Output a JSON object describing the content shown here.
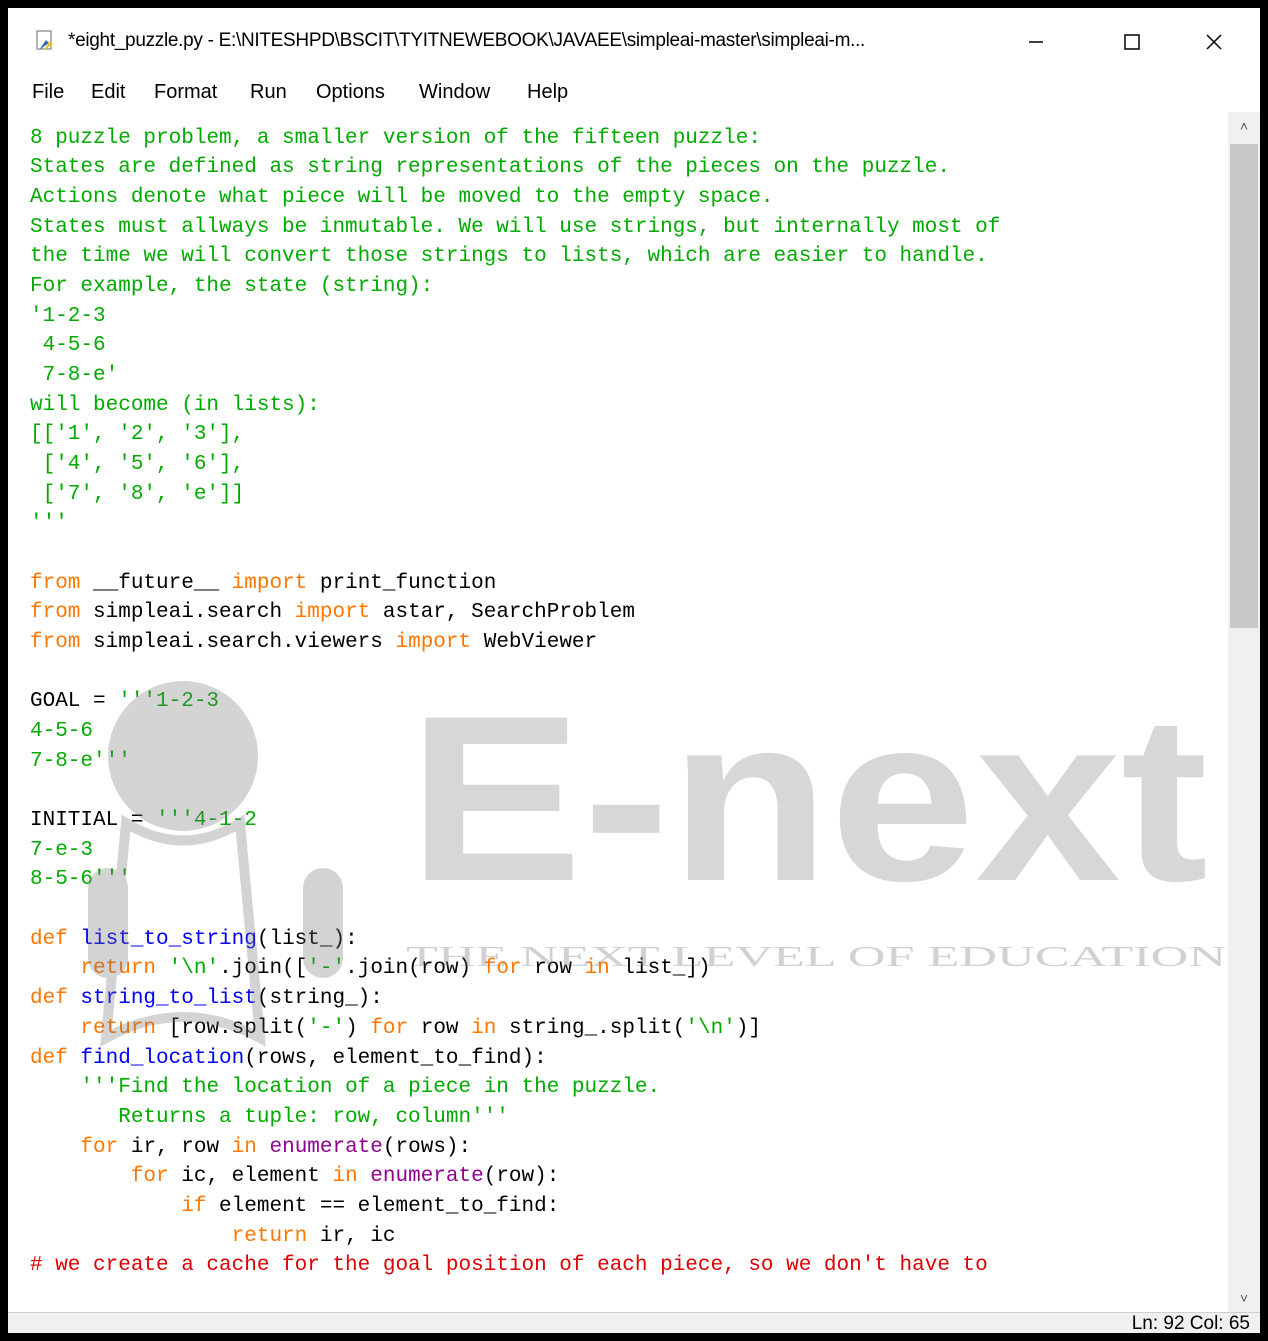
{
  "window": {
    "title": "*eight_puzzle.py - E:\\NITESHPD\\BSCIT\\TYITNEWEBOOK\\JAVAEE\\simpleai-master\\simpleai-m...",
    "minimize_icon": "minimize-icon",
    "maximize_icon": "maximize-icon",
    "close_icon": "close-icon"
  },
  "menu": {
    "items": [
      "File",
      "Edit",
      "Format",
      "Run",
      "Options",
      "Window",
      "Help"
    ]
  },
  "editor": {
    "lines": [
      [
        {
          "t": "'''",
          "c": "str"
        }
      ],
      [
        {
          "t": "8 puzzle problem, a smaller version of the fifteen puzzle:",
          "c": "str"
        }
      ],
      [
        {
          "t": "States are defined as string representations of the pieces on the puzzle.",
          "c": "str"
        }
      ],
      [
        {
          "t": "Actions denote what piece will be moved to the empty space.",
          "c": "str"
        }
      ],
      [
        {
          "t": "States must allways be inmutable. We will use strings, but internally most of",
          "c": "str"
        }
      ],
      [
        {
          "t": "the time we will convert those strings to lists, which are easier to handle.",
          "c": "str"
        }
      ],
      [
        {
          "t": "For example, the state (string):",
          "c": "str"
        }
      ],
      [
        {
          "t": "'1-2-3",
          "c": "str"
        }
      ],
      [
        {
          "t": " 4-5-6",
          "c": "str"
        }
      ],
      [
        {
          "t": " 7-8-e'",
          "c": "str"
        }
      ],
      [
        {
          "t": "will become (in lists):",
          "c": "str"
        }
      ],
      [
        {
          "t": "[['1', '2', '3'],",
          "c": "str"
        }
      ],
      [
        {
          "t": " ['4', '5', '6'],",
          "c": "str"
        }
      ],
      [
        {
          "t": " ['7', '8', 'e']]",
          "c": "str"
        }
      ],
      [
        {
          "t": "'''",
          "c": "str"
        }
      ],
      [],
      [
        {
          "t": "from",
          "c": "kw"
        },
        {
          "t": " __future__ "
        },
        {
          "t": "import",
          "c": "kw"
        },
        {
          "t": " print_function"
        }
      ],
      [
        {
          "t": "from",
          "c": "kw"
        },
        {
          "t": " simpleai.search "
        },
        {
          "t": "import",
          "c": "kw"
        },
        {
          "t": " astar, SearchProblem"
        }
      ],
      [
        {
          "t": "from",
          "c": "kw"
        },
        {
          "t": " simpleai.search.viewers "
        },
        {
          "t": "import",
          "c": "kw"
        },
        {
          "t": " WebViewer"
        }
      ],
      [],
      [
        {
          "t": "GOAL = "
        },
        {
          "t": "'''1-2-3",
          "c": "str"
        }
      ],
      [
        {
          "t": "4-5-6",
          "c": "str"
        }
      ],
      [
        {
          "t": "7-8-e'''",
          "c": "str"
        }
      ],
      [],
      [
        {
          "t": "INITIAL = "
        },
        {
          "t": "'''4-1-2",
          "c": "str"
        }
      ],
      [
        {
          "t": "7-e-3",
          "c": "str"
        }
      ],
      [
        {
          "t": "8-5-6'''",
          "c": "str"
        }
      ],
      [],
      [
        {
          "t": "def",
          "c": "kw"
        },
        {
          "t": " "
        },
        {
          "t": "list_to_string",
          "c": "def"
        },
        {
          "t": "(list_):"
        }
      ],
      [
        {
          "t": "    "
        },
        {
          "t": "return",
          "c": "kw"
        },
        {
          "t": " "
        },
        {
          "t": "'\\n'",
          "c": "str"
        },
        {
          "t": ".join(["
        },
        {
          "t": "'-'",
          "c": "str"
        },
        {
          "t": ".join(row) "
        },
        {
          "t": "for",
          "c": "kw"
        },
        {
          "t": " row "
        },
        {
          "t": "in",
          "c": "kw"
        },
        {
          "t": " list_])"
        }
      ],
      [
        {
          "t": "def",
          "c": "kw"
        },
        {
          "t": " "
        },
        {
          "t": "string_to_list",
          "c": "def"
        },
        {
          "t": "(string_):"
        }
      ],
      [
        {
          "t": "    "
        },
        {
          "t": "return",
          "c": "kw"
        },
        {
          "t": " [row.split("
        },
        {
          "t": "'-'",
          "c": "str"
        },
        {
          "t": ") "
        },
        {
          "t": "for",
          "c": "kw"
        },
        {
          "t": " row "
        },
        {
          "t": "in",
          "c": "kw"
        },
        {
          "t": " string_.split("
        },
        {
          "t": "'\\n'",
          "c": "str"
        },
        {
          "t": ")]"
        }
      ],
      [
        {
          "t": "def",
          "c": "kw"
        },
        {
          "t": " "
        },
        {
          "t": "find_location",
          "c": "def"
        },
        {
          "t": "(rows, element_to_find):"
        }
      ],
      [
        {
          "t": "    "
        },
        {
          "t": "'''Find the location of a piece in the puzzle.",
          "c": "str"
        }
      ],
      [
        {
          "t": "       Returns a tuple: row, column'''",
          "c": "str"
        }
      ],
      [
        {
          "t": "    "
        },
        {
          "t": "for",
          "c": "kw"
        },
        {
          "t": " ir, row "
        },
        {
          "t": "in",
          "c": "kw"
        },
        {
          "t": " "
        },
        {
          "t": "enumerate",
          "c": "bi"
        },
        {
          "t": "(rows):"
        }
      ],
      [
        {
          "t": "        "
        },
        {
          "t": "for",
          "c": "kw"
        },
        {
          "t": " ic, element "
        },
        {
          "t": "in",
          "c": "kw"
        },
        {
          "t": " "
        },
        {
          "t": "enumerate",
          "c": "bi"
        },
        {
          "t": "(row):"
        }
      ],
      [
        {
          "t": "            "
        },
        {
          "t": "if",
          "c": "kw"
        },
        {
          "t": " element == element_to_find:"
        }
      ],
      [
        {
          "t": "                "
        },
        {
          "t": "return",
          "c": "kw"
        },
        {
          "t": " ir, ic"
        }
      ],
      [
        {
          "t": "# we create a cache for the goal position of each piece, so we don't have to",
          "c": "cm"
        }
      ]
    ]
  },
  "watermark": {
    "logo_text": "E-next",
    "tagline": "THE NEXT LEVEL OF EDUCATION"
  },
  "status": {
    "text": "Ln: 92   Col: 65"
  },
  "colors": {
    "string": "#00aa00",
    "keyword": "#ff7700",
    "def_name": "#0000ff",
    "builtin": "#900090",
    "comment": "#dd0000"
  }
}
